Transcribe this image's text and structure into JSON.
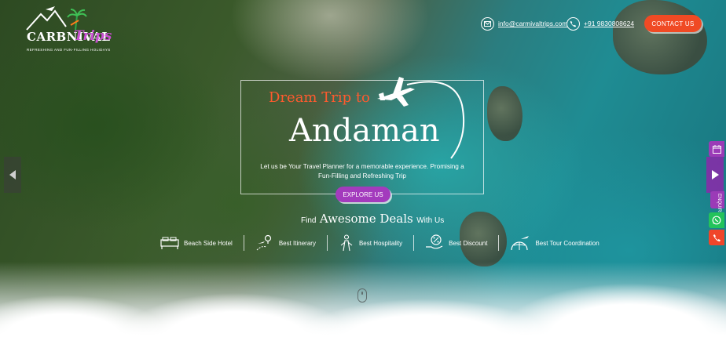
{
  "brand": {
    "name_part1": "CARBNIVAL",
    "name_part2": "Trips",
    "tagline": "REFRESHING AND FUN-FILLING HOLIDAYS",
    "accent": "#f04a24",
    "purple": "#a33bbd"
  },
  "header": {
    "email": "info@carmivaltrips.com",
    "phone": "+91 9830808624",
    "contact_button": "CONTACT US"
  },
  "hero": {
    "kicker": "Dream Trip to",
    "title": "Andaman",
    "description": "Let us be Your Travel Planner for a memorable experience. Promising a Fun-Filling and Refreshing Trip",
    "explore_button": "EXPLORE US"
  },
  "deals": {
    "prefix": "Find",
    "highlight": "Awesome Deals",
    "suffix": "With Us",
    "features": [
      {
        "label": "Beach Side Hotel",
        "icon": "bed-icon"
      },
      {
        "label": "Best Itinerary",
        "icon": "route-icon"
      },
      {
        "label": "Best Hospitality",
        "icon": "hospitality-icon"
      },
      {
        "label": "Best Discount",
        "icon": "discount-icon"
      },
      {
        "label": "Best Tour Coordination",
        "icon": "globe-plane-icon"
      }
    ]
  },
  "side_dock": {
    "tab_label": "ENQUIRE",
    "colors": {
      "whatsapp": "#23c35b",
      "call": "#f0462a"
    }
  }
}
